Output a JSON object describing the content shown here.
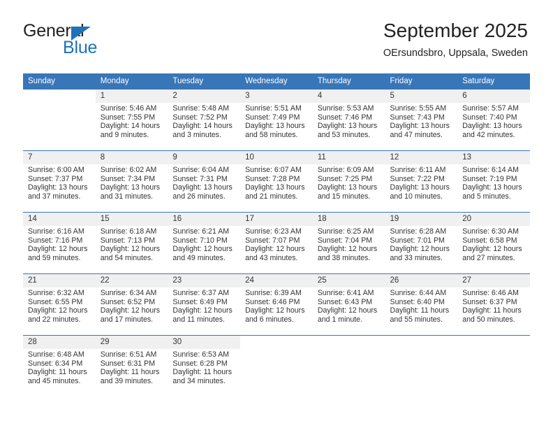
{
  "brand": {
    "name_top": "General",
    "name_bottom": "Blue",
    "accent_color": "#1f71b8",
    "triangle_icon": "triangle-icon"
  },
  "header": {
    "title": "September 2025",
    "subtitle": "OErsundsbro, Uppsala, Sweden"
  },
  "calendar": {
    "header_bg": "#3876b8",
    "daynum_bg": "#f0f0f0",
    "weekday_headers": [
      "Sunday",
      "Monday",
      "Tuesday",
      "Wednesday",
      "Thursday",
      "Friday",
      "Saturday"
    ],
    "weeks": [
      [
        {
          "day": "",
          "empty": true
        },
        {
          "day": "1",
          "sunrise": "Sunrise: 5:46 AM",
          "sunset": "Sunset: 7:55 PM",
          "daylight1": "Daylight: 14 hours",
          "daylight2": "and 9 minutes."
        },
        {
          "day": "2",
          "sunrise": "Sunrise: 5:48 AM",
          "sunset": "Sunset: 7:52 PM",
          "daylight1": "Daylight: 14 hours",
          "daylight2": "and 3 minutes."
        },
        {
          "day": "3",
          "sunrise": "Sunrise: 5:51 AM",
          "sunset": "Sunset: 7:49 PM",
          "daylight1": "Daylight: 13 hours",
          "daylight2": "and 58 minutes."
        },
        {
          "day": "4",
          "sunrise": "Sunrise: 5:53 AM",
          "sunset": "Sunset: 7:46 PM",
          "daylight1": "Daylight: 13 hours",
          "daylight2": "and 53 minutes."
        },
        {
          "day": "5",
          "sunrise": "Sunrise: 5:55 AM",
          "sunset": "Sunset: 7:43 PM",
          "daylight1": "Daylight: 13 hours",
          "daylight2": "and 47 minutes."
        },
        {
          "day": "6",
          "sunrise": "Sunrise: 5:57 AM",
          "sunset": "Sunset: 7:40 PM",
          "daylight1": "Daylight: 13 hours",
          "daylight2": "and 42 minutes."
        }
      ],
      [
        {
          "day": "7",
          "sunrise": "Sunrise: 6:00 AM",
          "sunset": "Sunset: 7:37 PM",
          "daylight1": "Daylight: 13 hours",
          "daylight2": "and 37 minutes."
        },
        {
          "day": "8",
          "sunrise": "Sunrise: 6:02 AM",
          "sunset": "Sunset: 7:34 PM",
          "daylight1": "Daylight: 13 hours",
          "daylight2": "and 31 minutes."
        },
        {
          "day": "9",
          "sunrise": "Sunrise: 6:04 AM",
          "sunset": "Sunset: 7:31 PM",
          "daylight1": "Daylight: 13 hours",
          "daylight2": "and 26 minutes."
        },
        {
          "day": "10",
          "sunrise": "Sunrise: 6:07 AM",
          "sunset": "Sunset: 7:28 PM",
          "daylight1": "Daylight: 13 hours",
          "daylight2": "and 21 minutes."
        },
        {
          "day": "11",
          "sunrise": "Sunrise: 6:09 AM",
          "sunset": "Sunset: 7:25 PM",
          "daylight1": "Daylight: 13 hours",
          "daylight2": "and 15 minutes."
        },
        {
          "day": "12",
          "sunrise": "Sunrise: 6:11 AM",
          "sunset": "Sunset: 7:22 PM",
          "daylight1": "Daylight: 13 hours",
          "daylight2": "and 10 minutes."
        },
        {
          "day": "13",
          "sunrise": "Sunrise: 6:14 AM",
          "sunset": "Sunset: 7:19 PM",
          "daylight1": "Daylight: 13 hours",
          "daylight2": "and 5 minutes."
        }
      ],
      [
        {
          "day": "14",
          "sunrise": "Sunrise: 6:16 AM",
          "sunset": "Sunset: 7:16 PM",
          "daylight1": "Daylight: 12 hours",
          "daylight2": "and 59 minutes."
        },
        {
          "day": "15",
          "sunrise": "Sunrise: 6:18 AM",
          "sunset": "Sunset: 7:13 PM",
          "daylight1": "Daylight: 12 hours",
          "daylight2": "and 54 minutes."
        },
        {
          "day": "16",
          "sunrise": "Sunrise: 6:21 AM",
          "sunset": "Sunset: 7:10 PM",
          "daylight1": "Daylight: 12 hours",
          "daylight2": "and 49 minutes."
        },
        {
          "day": "17",
          "sunrise": "Sunrise: 6:23 AM",
          "sunset": "Sunset: 7:07 PM",
          "daylight1": "Daylight: 12 hours",
          "daylight2": "and 43 minutes."
        },
        {
          "day": "18",
          "sunrise": "Sunrise: 6:25 AM",
          "sunset": "Sunset: 7:04 PM",
          "daylight1": "Daylight: 12 hours",
          "daylight2": "and 38 minutes."
        },
        {
          "day": "19",
          "sunrise": "Sunrise: 6:28 AM",
          "sunset": "Sunset: 7:01 PM",
          "daylight1": "Daylight: 12 hours",
          "daylight2": "and 33 minutes."
        },
        {
          "day": "20",
          "sunrise": "Sunrise: 6:30 AM",
          "sunset": "Sunset: 6:58 PM",
          "daylight1": "Daylight: 12 hours",
          "daylight2": "and 27 minutes."
        }
      ],
      [
        {
          "day": "21",
          "sunrise": "Sunrise: 6:32 AM",
          "sunset": "Sunset: 6:55 PM",
          "daylight1": "Daylight: 12 hours",
          "daylight2": "and 22 minutes."
        },
        {
          "day": "22",
          "sunrise": "Sunrise: 6:34 AM",
          "sunset": "Sunset: 6:52 PM",
          "daylight1": "Daylight: 12 hours",
          "daylight2": "and 17 minutes."
        },
        {
          "day": "23",
          "sunrise": "Sunrise: 6:37 AM",
          "sunset": "Sunset: 6:49 PM",
          "daylight1": "Daylight: 12 hours",
          "daylight2": "and 11 minutes."
        },
        {
          "day": "24",
          "sunrise": "Sunrise: 6:39 AM",
          "sunset": "Sunset: 6:46 PM",
          "daylight1": "Daylight: 12 hours",
          "daylight2": "and 6 minutes."
        },
        {
          "day": "25",
          "sunrise": "Sunrise: 6:41 AM",
          "sunset": "Sunset: 6:43 PM",
          "daylight1": "Daylight: 12 hours",
          "daylight2": "and 1 minute."
        },
        {
          "day": "26",
          "sunrise": "Sunrise: 6:44 AM",
          "sunset": "Sunset: 6:40 PM",
          "daylight1": "Daylight: 11 hours",
          "daylight2": "and 55 minutes."
        },
        {
          "day": "27",
          "sunrise": "Sunrise: 6:46 AM",
          "sunset": "Sunset: 6:37 PM",
          "daylight1": "Daylight: 11 hours",
          "daylight2": "and 50 minutes."
        }
      ],
      [
        {
          "day": "28",
          "sunrise": "Sunrise: 6:48 AM",
          "sunset": "Sunset: 6:34 PM",
          "daylight1": "Daylight: 11 hours",
          "daylight2": "and 45 minutes."
        },
        {
          "day": "29",
          "sunrise": "Sunrise: 6:51 AM",
          "sunset": "Sunset: 6:31 PM",
          "daylight1": "Daylight: 11 hours",
          "daylight2": "and 39 minutes."
        },
        {
          "day": "30",
          "sunrise": "Sunrise: 6:53 AM",
          "sunset": "Sunset: 6:28 PM",
          "daylight1": "Daylight: 11 hours",
          "daylight2": "and 34 minutes."
        },
        {
          "day": "",
          "empty": true
        },
        {
          "day": "",
          "empty": true
        },
        {
          "day": "",
          "empty": true
        },
        {
          "day": "",
          "empty": true
        }
      ]
    ]
  }
}
